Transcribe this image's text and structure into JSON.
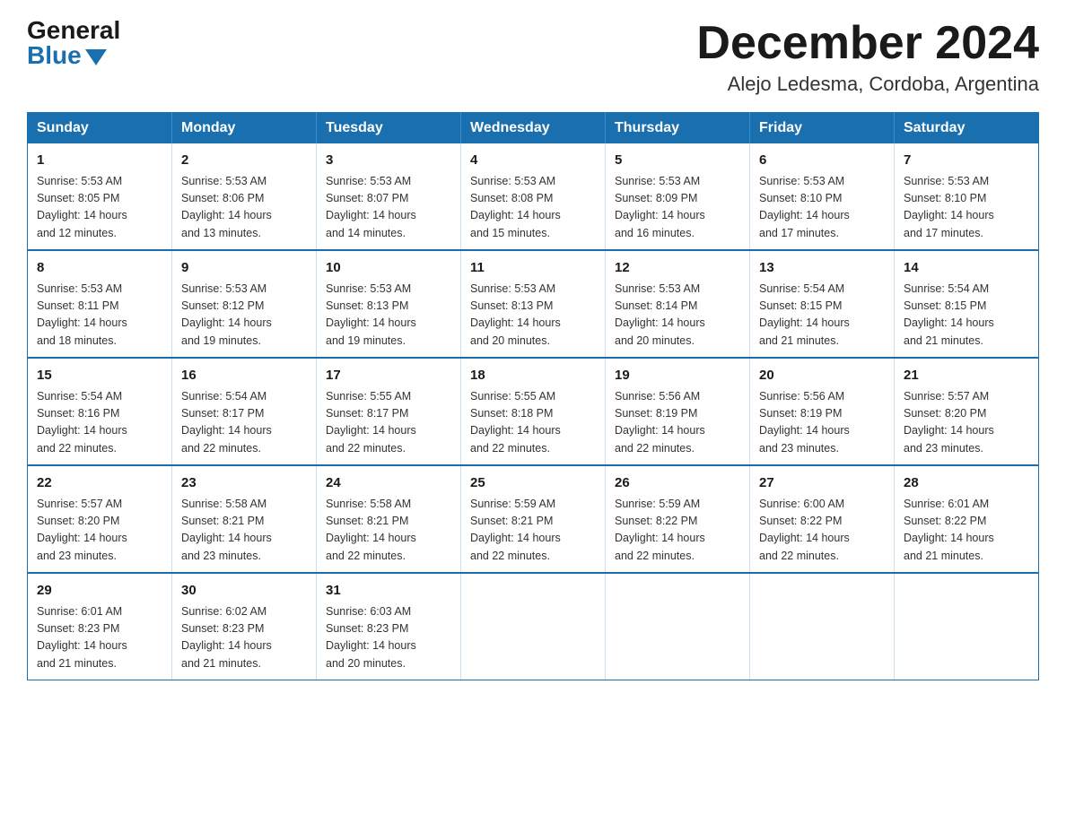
{
  "header": {
    "logo_general": "General",
    "logo_blue": "Blue",
    "month_title": "December 2024",
    "location": "Alejo Ledesma, Cordoba, Argentina"
  },
  "days_of_week": [
    "Sunday",
    "Monday",
    "Tuesday",
    "Wednesday",
    "Thursday",
    "Friday",
    "Saturday"
  ],
  "weeks": [
    [
      {
        "day": "1",
        "sunrise": "5:53 AM",
        "sunset": "8:05 PM",
        "daylight": "14 hours and 12 minutes."
      },
      {
        "day": "2",
        "sunrise": "5:53 AM",
        "sunset": "8:06 PM",
        "daylight": "14 hours and 13 minutes."
      },
      {
        "day": "3",
        "sunrise": "5:53 AM",
        "sunset": "8:07 PM",
        "daylight": "14 hours and 14 minutes."
      },
      {
        "day": "4",
        "sunrise": "5:53 AM",
        "sunset": "8:08 PM",
        "daylight": "14 hours and 15 minutes."
      },
      {
        "day": "5",
        "sunrise": "5:53 AM",
        "sunset": "8:09 PM",
        "daylight": "14 hours and 16 minutes."
      },
      {
        "day": "6",
        "sunrise": "5:53 AM",
        "sunset": "8:10 PM",
        "daylight": "14 hours and 17 minutes."
      },
      {
        "day": "7",
        "sunrise": "5:53 AM",
        "sunset": "8:10 PM",
        "daylight": "14 hours and 17 minutes."
      }
    ],
    [
      {
        "day": "8",
        "sunrise": "5:53 AM",
        "sunset": "8:11 PM",
        "daylight": "14 hours and 18 minutes."
      },
      {
        "day": "9",
        "sunrise": "5:53 AM",
        "sunset": "8:12 PM",
        "daylight": "14 hours and 19 minutes."
      },
      {
        "day": "10",
        "sunrise": "5:53 AM",
        "sunset": "8:13 PM",
        "daylight": "14 hours and 19 minutes."
      },
      {
        "day": "11",
        "sunrise": "5:53 AM",
        "sunset": "8:13 PM",
        "daylight": "14 hours and 20 minutes."
      },
      {
        "day": "12",
        "sunrise": "5:53 AM",
        "sunset": "8:14 PM",
        "daylight": "14 hours and 20 minutes."
      },
      {
        "day": "13",
        "sunrise": "5:54 AM",
        "sunset": "8:15 PM",
        "daylight": "14 hours and 21 minutes."
      },
      {
        "day": "14",
        "sunrise": "5:54 AM",
        "sunset": "8:15 PM",
        "daylight": "14 hours and 21 minutes."
      }
    ],
    [
      {
        "day": "15",
        "sunrise": "5:54 AM",
        "sunset": "8:16 PM",
        "daylight": "14 hours and 22 minutes."
      },
      {
        "day": "16",
        "sunrise": "5:54 AM",
        "sunset": "8:17 PM",
        "daylight": "14 hours and 22 minutes."
      },
      {
        "day": "17",
        "sunrise": "5:55 AM",
        "sunset": "8:17 PM",
        "daylight": "14 hours and 22 minutes."
      },
      {
        "day": "18",
        "sunrise": "5:55 AM",
        "sunset": "8:18 PM",
        "daylight": "14 hours and 22 minutes."
      },
      {
        "day": "19",
        "sunrise": "5:56 AM",
        "sunset": "8:19 PM",
        "daylight": "14 hours and 22 minutes."
      },
      {
        "day": "20",
        "sunrise": "5:56 AM",
        "sunset": "8:19 PM",
        "daylight": "14 hours and 23 minutes."
      },
      {
        "day": "21",
        "sunrise": "5:57 AM",
        "sunset": "8:20 PM",
        "daylight": "14 hours and 23 minutes."
      }
    ],
    [
      {
        "day": "22",
        "sunrise": "5:57 AM",
        "sunset": "8:20 PM",
        "daylight": "14 hours and 23 minutes."
      },
      {
        "day": "23",
        "sunrise": "5:58 AM",
        "sunset": "8:21 PM",
        "daylight": "14 hours and 23 minutes."
      },
      {
        "day": "24",
        "sunrise": "5:58 AM",
        "sunset": "8:21 PM",
        "daylight": "14 hours and 22 minutes."
      },
      {
        "day": "25",
        "sunrise": "5:59 AM",
        "sunset": "8:21 PM",
        "daylight": "14 hours and 22 minutes."
      },
      {
        "day": "26",
        "sunrise": "5:59 AM",
        "sunset": "8:22 PM",
        "daylight": "14 hours and 22 minutes."
      },
      {
        "day": "27",
        "sunrise": "6:00 AM",
        "sunset": "8:22 PM",
        "daylight": "14 hours and 22 minutes."
      },
      {
        "day": "28",
        "sunrise": "6:01 AM",
        "sunset": "8:22 PM",
        "daylight": "14 hours and 21 minutes."
      }
    ],
    [
      {
        "day": "29",
        "sunrise": "6:01 AM",
        "sunset": "8:23 PM",
        "daylight": "14 hours and 21 minutes."
      },
      {
        "day": "30",
        "sunrise": "6:02 AM",
        "sunset": "8:23 PM",
        "daylight": "14 hours and 21 minutes."
      },
      {
        "day": "31",
        "sunrise": "6:03 AM",
        "sunset": "8:23 PM",
        "daylight": "14 hours and 20 minutes."
      },
      null,
      null,
      null,
      null
    ]
  ],
  "labels": {
    "sunrise": "Sunrise:",
    "sunset": "Sunset:",
    "daylight": "Daylight:"
  }
}
